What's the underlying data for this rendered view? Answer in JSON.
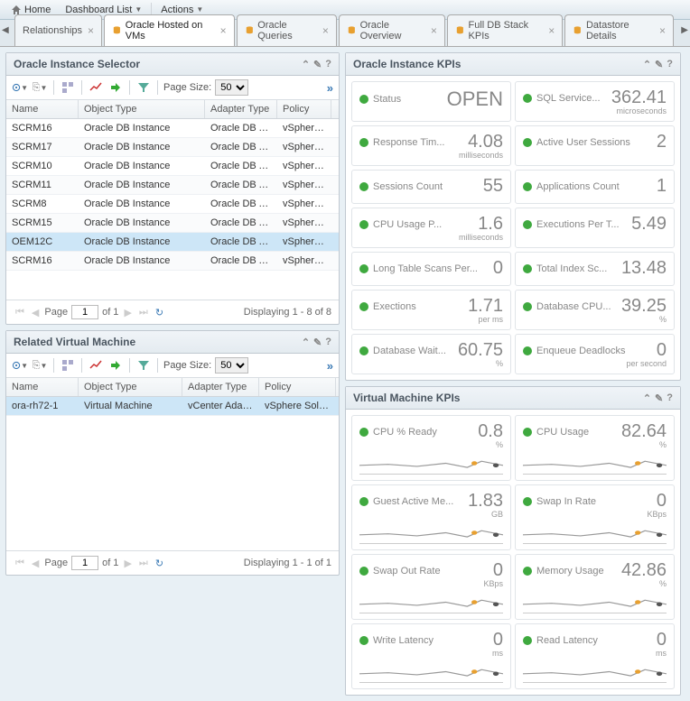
{
  "topnav": {
    "home": "Home",
    "dashboard_list": "Dashboard List",
    "actions": "Actions"
  },
  "tabs": [
    {
      "label": "Relationships",
      "active": false,
      "icon": false
    },
    {
      "label": "Oracle Hosted on VMs",
      "active": true,
      "icon": true
    },
    {
      "label": "Oracle Queries",
      "active": false,
      "icon": true
    },
    {
      "label": "Oracle Overview",
      "active": false,
      "icon": true
    },
    {
      "label": "Full DB Stack KPIs",
      "active": false,
      "icon": true
    },
    {
      "label": "Datastore Details",
      "active": false,
      "icon": true
    }
  ],
  "instance_selector": {
    "title": "Oracle Instance Selector",
    "page_size_label": "Page Size:",
    "page_size": "50",
    "columns": {
      "name": "Name",
      "object_type": "Object Type",
      "adapter_type": "Adapter Type",
      "policy": "Policy"
    },
    "rows": [
      {
        "name": "SCRM16",
        "object_type": "Oracle DB Instance",
        "adapter_type": "Oracle DB Ad...",
        "policy": "vSphere Sc",
        "selected": false
      },
      {
        "name": "SCRM17",
        "object_type": "Oracle DB Instance",
        "adapter_type": "Oracle DB Ad...",
        "policy": "vSphere Sc",
        "selected": false
      },
      {
        "name": "SCRM10",
        "object_type": "Oracle DB Instance",
        "adapter_type": "Oracle DB Ad...",
        "policy": "vSphere Sc",
        "selected": false
      },
      {
        "name": "SCRM11",
        "object_type": "Oracle DB Instance",
        "adapter_type": "Oracle DB Ad...",
        "policy": "vSphere Sc",
        "selected": false
      },
      {
        "name": "SCRM8",
        "object_type": "Oracle DB Instance",
        "adapter_type": "Oracle DB Ad...",
        "policy": "vSphere Sc",
        "selected": false
      },
      {
        "name": "SCRM15",
        "object_type": "Oracle DB Instance",
        "adapter_type": "Oracle DB Ad...",
        "policy": "vSphere Sc",
        "selected": false
      },
      {
        "name": "OEM12C",
        "object_type": "Oracle DB Instance",
        "adapter_type": "Oracle DB Ad...",
        "policy": "vSphere Sc",
        "selected": true
      },
      {
        "name": "SCRM16",
        "object_type": "Oracle DB Instance",
        "adapter_type": "Oracle DB Ad...",
        "policy": "vSphere Sc",
        "selected": false
      }
    ],
    "pager": {
      "page_label": "Page",
      "page": "1",
      "of_label": "of 1",
      "status": "Displaying 1 - 8 of 8"
    }
  },
  "related_vm": {
    "title": "Related Virtual Machine",
    "page_size_label": "Page Size:",
    "page_size": "50",
    "columns": {
      "name": "Name",
      "object_type": "Object Type",
      "adapter_type": "Adapter Type",
      "policy": "Policy"
    },
    "rows": [
      {
        "name": "ora-rh72-1",
        "object_type": "Virtual Machine",
        "adapter_type": "vCenter Adap...",
        "policy": "vSphere Solu...",
        "selected": true
      }
    ],
    "pager": {
      "page_label": "Page",
      "page": "1",
      "of_label": "of 1",
      "status": "Displaying 1 - 1 of 1"
    }
  },
  "instance_kpis": {
    "title": "Oracle Instance KPIs",
    "cards": [
      {
        "label": "Status",
        "value": "OPEN",
        "unit": ""
      },
      {
        "label": "SQL Service...",
        "value": "362.41",
        "unit": "microseconds"
      },
      {
        "label": "Response Tim...",
        "value": "4.08",
        "unit": "milliseconds"
      },
      {
        "label": "Active User Sessions",
        "value": "2",
        "unit": ""
      },
      {
        "label": "Sessions Count",
        "value": "55",
        "unit": ""
      },
      {
        "label": "Applications Count",
        "value": "1",
        "unit": ""
      },
      {
        "label": "CPU Usage P...",
        "value": "1.6",
        "unit": "milliseconds"
      },
      {
        "label": "Executions Per T...",
        "value": "5.49",
        "unit": ""
      },
      {
        "label": "Long Table Scans Per...",
        "value": "0",
        "unit": ""
      },
      {
        "label": "Total Index Sc...",
        "value": "13.48",
        "unit": ""
      },
      {
        "label": "Exections",
        "value": "1.71",
        "unit": "per ms"
      },
      {
        "label": "Database CPU...",
        "value": "39.25",
        "unit": "%"
      },
      {
        "label": "Database Wait...",
        "value": "60.75",
        "unit": "%"
      },
      {
        "label": "Enqueue Deadlocks",
        "value": "0",
        "unit": "per second"
      }
    ]
  },
  "vm_kpis": {
    "title": "Virtual Machine KPIs",
    "cards": [
      {
        "label": "CPU % Ready",
        "value": "0.8",
        "unit": "%",
        "spark": true
      },
      {
        "label": "CPU Usage",
        "value": "82.64",
        "unit": "%",
        "spark": true
      },
      {
        "label": "Guest Active Me...",
        "value": "1.83",
        "unit": "GB",
        "spark": true
      },
      {
        "label": "Swap In Rate",
        "value": "0",
        "unit": "KBps",
        "spark": true
      },
      {
        "label": "Swap Out Rate",
        "value": "0",
        "unit": "KBps",
        "spark": true
      },
      {
        "label": "Memory Usage",
        "value": "42.86",
        "unit": "%",
        "spark": true
      },
      {
        "label": "Write Latency",
        "value": "0",
        "unit": "ms",
        "spark": true
      },
      {
        "label": "Read Latency",
        "value": "0",
        "unit": "ms",
        "spark": true
      }
    ]
  }
}
